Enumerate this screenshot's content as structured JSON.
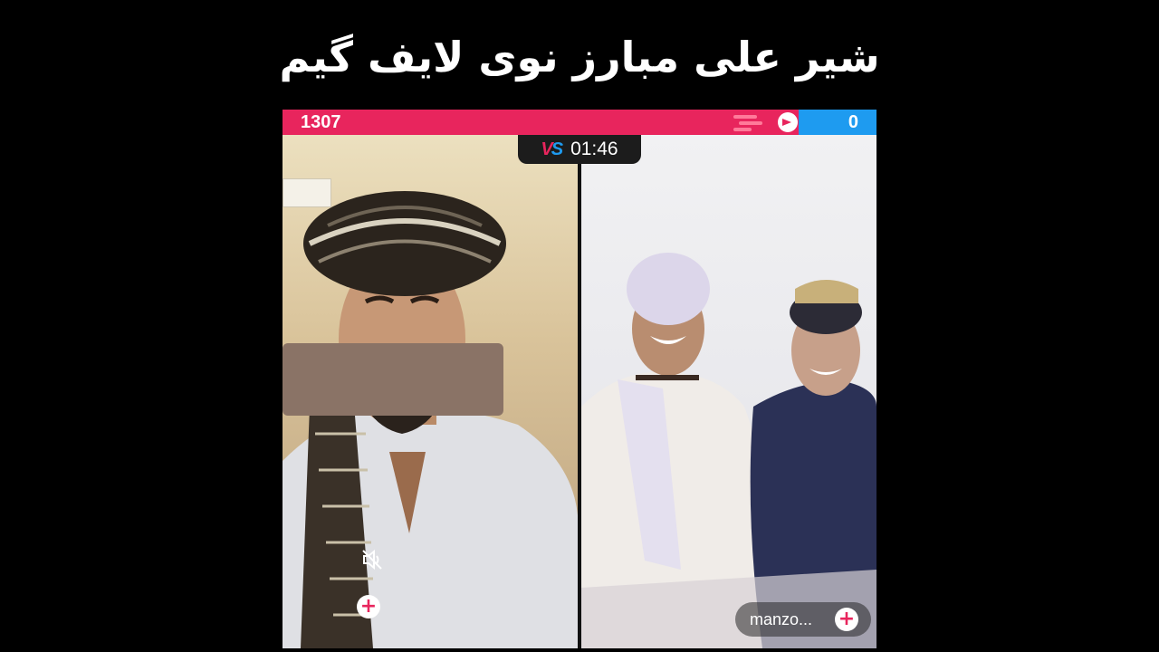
{
  "title": "شیر علی مبارز نوی لایف گیم",
  "battle": {
    "score_left": "1307",
    "score_right": "0",
    "timer": "01:46",
    "vs_icon": "vs-icon",
    "colors": {
      "left_team": "#e8255d",
      "right_team": "#1e9bf0"
    }
  },
  "left_participant": {
    "status_icon": "mute-icon",
    "add_icon": "plus-icon"
  },
  "right_participant": {
    "name": "manzo...",
    "add_icon": "plus-icon"
  }
}
